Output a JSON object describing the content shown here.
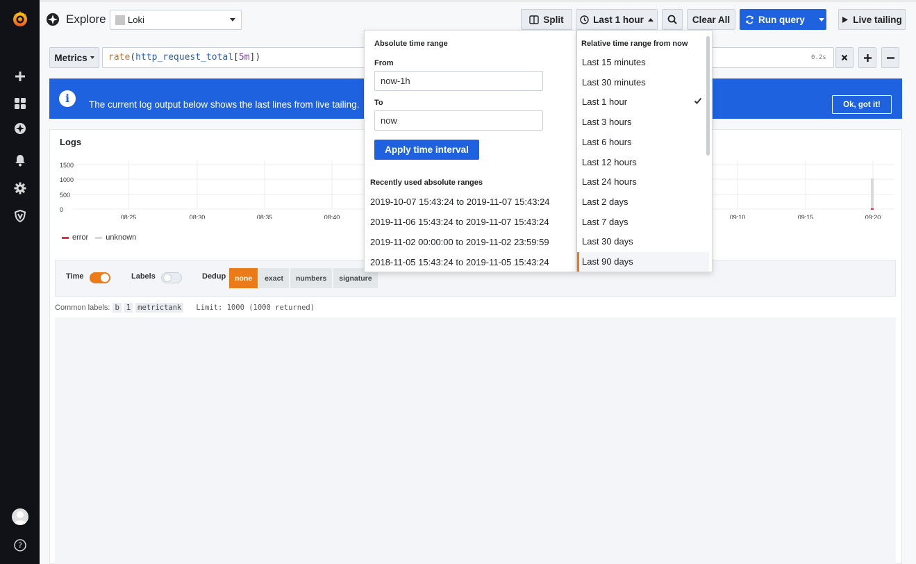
{
  "navbar": {
    "title": "Explore",
    "datasource": "Loki",
    "split_label": "Split",
    "time_range_label": "Last 1 hour",
    "clear_all_label": "Clear All",
    "run_query_label": "Run query",
    "live_tailing_label": "Live tailing"
  },
  "query": {
    "type_label": "Metrics",
    "fn": "rate",
    "metric": "http_request_total",
    "range": "5m",
    "duration": "0.2s"
  },
  "banner": {
    "text": "The current log output below shows the last lines from live tailing.",
    "ok_label": "Ok, got it!"
  },
  "logs": {
    "title": "Logs",
    "y_ticks": [
      "1500",
      "1000",
      "500",
      "0"
    ],
    "x_ticks_left": [
      "08:25",
      "08:30",
      "08:35",
      "08:40"
    ],
    "x_ticks_right": [
      "09:10",
      "09:15",
      "09:20"
    ],
    "legend": [
      {
        "label": "error",
        "color": "#e02f44"
      },
      {
        "label": "unknown",
        "color": "#d8d9da"
      }
    ],
    "options": {
      "time_label": "Time",
      "labels_label": "Labels",
      "dedup_label": "Dedup",
      "dedup_options": [
        "none",
        "exact",
        "numbers",
        "signature"
      ]
    },
    "common_labels_label": "Common labels:",
    "common_labels": [
      "b",
      "1",
      "metrictank"
    ],
    "limit_text": "Limit: 1000 (1000 returned)"
  },
  "time_picker": {
    "absolute_heading": "Absolute time range",
    "from_label": "From",
    "from_value": "now-1h",
    "to_label": "To",
    "to_value": "now",
    "apply_label": "Apply time interval",
    "recent_heading": "Recently used absolute ranges",
    "recent": [
      "2019-10-07 15:43:24 to 2019-11-07 15:43:24",
      "2019-11-06 15:43:24 to 2019-11-07 15:43:24",
      "2019-11-02 00:00:00 to 2019-11-02 23:59:59",
      "2018-11-05 15:43:24 to 2019-11-05 15:43:24"
    ],
    "relative_heading": "Relative time range from now",
    "relative": [
      "Last 15 minutes",
      "Last 30 minutes",
      "Last 1 hour",
      "Last 3 hours",
      "Last 6 hours",
      "Last 12 hours",
      "Last 24 hours",
      "Last 2 days",
      "Last 7 days",
      "Last 30 days",
      "Last 90 days"
    ],
    "selected": "Last 1 hour"
  },
  "colors": {
    "primary": "#1f62e0",
    "accent": "#eb7b18",
    "sidebar": "#111217"
  }
}
